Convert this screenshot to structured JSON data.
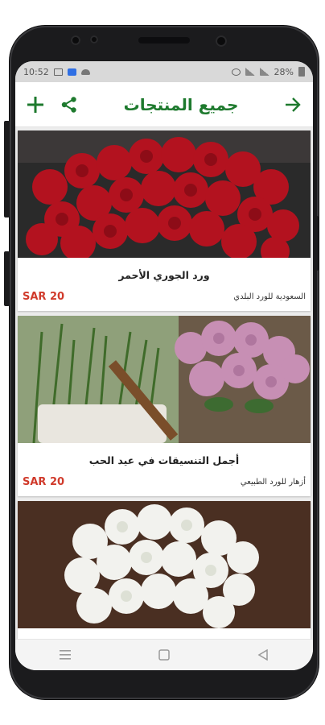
{
  "status_bar": {
    "time": "10:52",
    "battery": "28%"
  },
  "app_bar": {
    "title": "جميع المنتجات",
    "icons": {
      "add": "plus-icon",
      "share": "share-icon",
      "forward": "arrow-right-icon"
    }
  },
  "products": [
    {
      "name": "ورد الجوري الأحمر",
      "price": "SAR 20",
      "shop": "السعودية للورد البلدي",
      "image": "red-roses-bouquet"
    },
    {
      "name": "أجمل التنسيقات في عيد الحب",
      "price": "SAR 20",
      "shop": "أزهار للورد الطبيعي",
      "image": "pink-roses-arrangement"
    },
    {
      "name": "",
      "price": "",
      "shop": "",
      "image": "white-roses-bouquet"
    }
  ],
  "nav_bar": {
    "icons": [
      "menu-icon",
      "home-icon",
      "back-icon"
    ]
  },
  "colors": {
    "accent": "#1e7a2e",
    "price": "#d03a2b"
  }
}
